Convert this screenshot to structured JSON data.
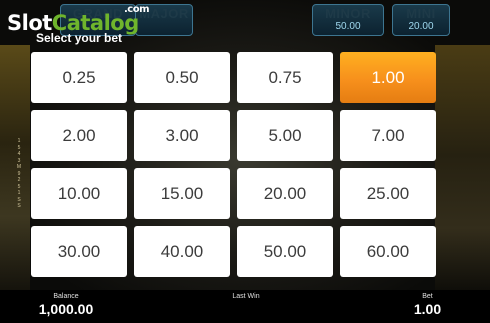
{
  "logo": {
    "part1": "Slot",
    "part2": "Catalog",
    "suffix": ".com"
  },
  "jackpots": [
    {
      "label": "GRAND",
      "value": ""
    },
    {
      "label": "MAJOR",
      "value": ""
    },
    {
      "label": "MINOR",
      "value": "50.00"
    },
    {
      "label": "MINI",
      "value": "20.00"
    }
  ],
  "title": "Select your bet",
  "bet_options": [
    "0.25",
    "0.50",
    "0.75",
    "1.00",
    "2.00",
    "3.00",
    "5.00",
    "7.00",
    "10.00",
    "15.00",
    "20.00",
    "25.00",
    "30.00",
    "40.00",
    "50.00",
    "60.00"
  ],
  "selected_bet": "1.00",
  "status": {
    "balance_label": "Balance",
    "balance_value": "1,000.00",
    "last_win_label": "Last Win",
    "last_win_value": "",
    "bet_label": "Bet",
    "bet_value": "1.00"
  },
  "colors": {
    "selected": "#f7901c",
    "button": "#ffffff",
    "button_text": "#3c3c3c"
  }
}
